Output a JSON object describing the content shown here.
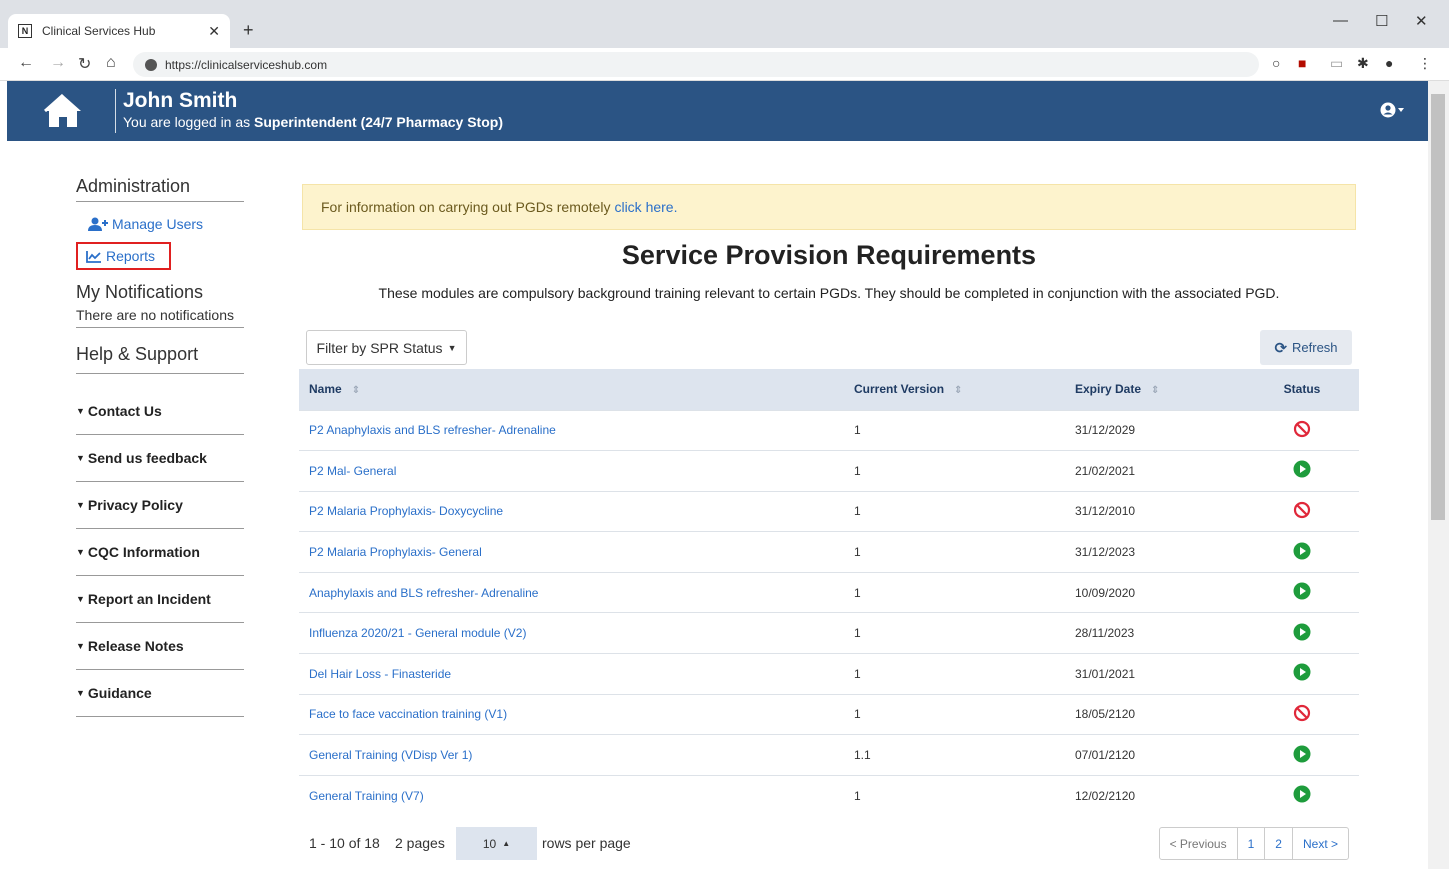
{
  "browser": {
    "tab_title": "Clinical Services Hub",
    "url": "https://clinicalserviceshub.com"
  },
  "header": {
    "user_name": "John Smith",
    "login_prefix": "You are logged in as ",
    "role": "Superintendent (24/7 Pharmacy Stop)"
  },
  "sidebar": {
    "admin_heading": "Administration",
    "manage_users": "Manage Users",
    "reports": "Reports",
    "notifications_heading": "My Notifications",
    "no_notifications": "There are no notifications",
    "help_heading": "Help & Support",
    "support_items": [
      "Contact Us",
      "Send us feedback",
      "Privacy Policy",
      "CQC Information",
      "Report an Incident",
      "Release Notes",
      "Guidance"
    ]
  },
  "main": {
    "alert_text": "For information on carrying out PGDs remotely",
    "alert_link": "click here.",
    "title": "Service Provision Requirements",
    "description": "These modules are compulsory background training relevant to certain PGDs. They should be completed in conjunction with the associated PGD.",
    "filter_label": "Filter by SPR Status",
    "refresh_label": "Refresh"
  },
  "table": {
    "columns": [
      "Name",
      "Current Version",
      "Expiry Date",
      "Status"
    ],
    "rows": [
      {
        "name": "P2 Anaphylaxis and BLS refresher- Adrenaline",
        "version": "1",
        "expiry": "31/12/2029",
        "status": "blocked"
      },
      {
        "name": "P2 Mal- General",
        "version": "1",
        "expiry": "21/02/2021",
        "status": "play"
      },
      {
        "name": "P2 Malaria Prophylaxis- Doxycycline",
        "version": "1",
        "expiry": "31/12/2010",
        "status": "blocked"
      },
      {
        "name": "P2 Malaria Prophylaxis- General",
        "version": "1",
        "expiry": "31/12/2023",
        "status": "play"
      },
      {
        "name": "Anaphylaxis and BLS refresher- Adrenaline",
        "version": "1",
        "expiry": "10/09/2020",
        "status": "play"
      },
      {
        "name": "Influenza 2020/21 - General module (V2)",
        "version": "1",
        "expiry": "28/11/2023",
        "status": "play"
      },
      {
        "name": "Del Hair Loss - Finasteride",
        "version": "1",
        "expiry": "31/01/2021",
        "status": "play"
      },
      {
        "name": "Face to face vaccination training  (V1)",
        "version": "1",
        "expiry": "18/05/2120",
        "status": "blocked"
      },
      {
        "name": "General Training (VDisp Ver 1)",
        "version": "1.1",
        "expiry": "07/01/2120",
        "status": "play"
      },
      {
        "name": "General Training (V7)",
        "version": "1",
        "expiry": "12/02/2120",
        "status": "play"
      }
    ]
  },
  "pager": {
    "info": "1 - 10 of 18",
    "pages": "2 pages",
    "rows_value": "10",
    "rows_label": "rows per page",
    "previous": "< Previous",
    "page1": "1",
    "page2": "2",
    "next": "Next >"
  },
  "colors": {
    "header_bg": "#2b5484",
    "blocked": "#e0283a",
    "play": "#1e9c3c",
    "alert_bg": "#fdf3cd"
  }
}
